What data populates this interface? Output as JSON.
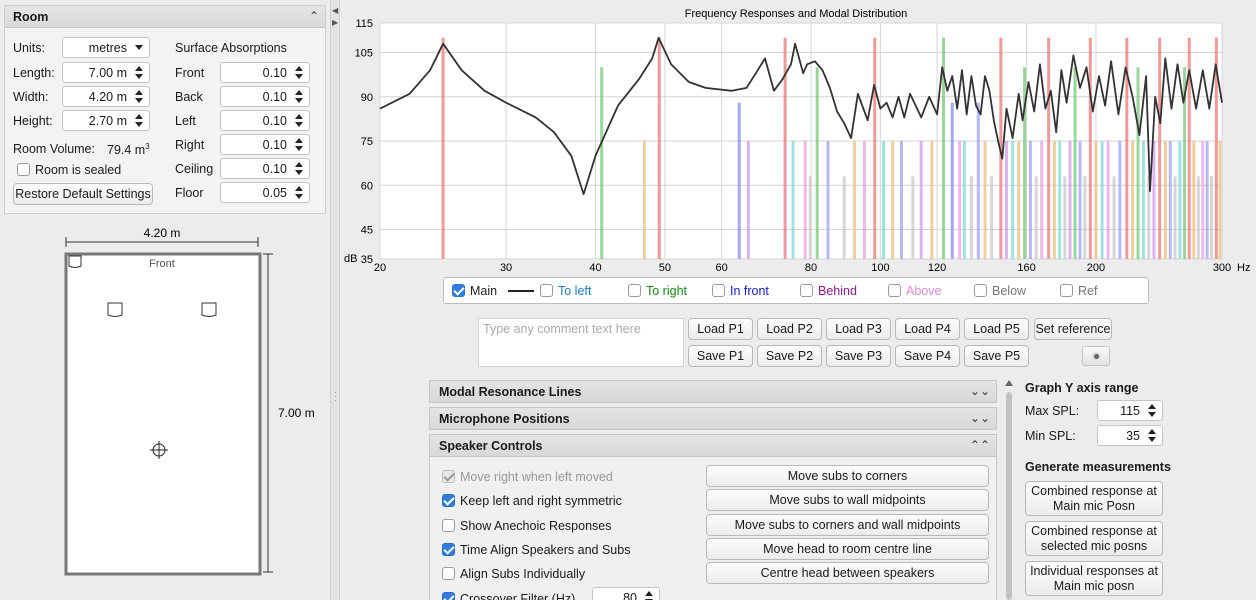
{
  "room": {
    "title": "Room",
    "units_label": "Units:",
    "units_value": "metres",
    "length_label": "Length:",
    "length_value": "7.00 m",
    "width_label": "Width:",
    "width_value": "4.20 m",
    "height_label": "Height:",
    "height_value": "2.70 m",
    "volume_label": "Room Volume:",
    "volume_value": "79.4 m",
    "volume_sup": "3",
    "sealed_label": "Room is sealed",
    "sealed_checked": false,
    "restore_label": "Restore Default Settings",
    "surface_title": "Surface Absorptions",
    "surfaces": [
      {
        "name": "Front",
        "value": "0.10"
      },
      {
        "name": "Back",
        "value": "0.10"
      },
      {
        "name": "Left",
        "value": "0.10"
      },
      {
        "name": "Right",
        "value": "0.10"
      },
      {
        "name": "Ceiling",
        "value": "0.10"
      },
      {
        "name": "Floor",
        "value": "0.05"
      }
    ]
  },
  "diagram": {
    "width_label": "4.20 m",
    "length_label": "7.00 m",
    "front_label": "Front"
  },
  "chart_data": {
    "type": "line",
    "title": "Frequency Responses and Modal Distribution",
    "xlabel": "Hz",
    "ylabel": "dB",
    "x_scale": "log",
    "xlim": [
      20,
      300
    ],
    "ylim": [
      35,
      115
    ],
    "x_ticks": [
      20,
      30,
      40,
      50,
      60,
      80,
      100,
      120,
      160,
      200,
      300
    ],
    "y_ticks": [
      35,
      45,
      60,
      75,
      90,
      105,
      115
    ],
    "grid": true,
    "series": [
      {
        "name": "Main",
        "color": "#333333",
        "points": [
          [
            20,
            86
          ],
          [
            22,
            91
          ],
          [
            23.5,
            99
          ],
          [
            24.5,
            108
          ],
          [
            26,
            99
          ],
          [
            28,
            92
          ],
          [
            30,
            88
          ],
          [
            33,
            83
          ],
          [
            35,
            78
          ],
          [
            37,
            70
          ],
          [
            38.5,
            57
          ],
          [
            40,
            70
          ],
          [
            43,
            87
          ],
          [
            46,
            96
          ],
          [
            48,
            103
          ],
          [
            49,
            110
          ],
          [
            51,
            101
          ],
          [
            54,
            95
          ],
          [
            57,
            93
          ],
          [
            62,
            92
          ],
          [
            65,
            93
          ],
          [
            67,
            98
          ],
          [
            69,
            103
          ],
          [
            71,
            92
          ],
          [
            73,
            96
          ],
          [
            75,
            101
          ],
          [
            76,
            108
          ],
          [
            78,
            98
          ],
          [
            79,
            101
          ],
          [
            81,
            102
          ],
          [
            83,
            99
          ],
          [
            85,
            93
          ],
          [
            87,
            85
          ],
          [
            89,
            81
          ],
          [
            91,
            76
          ],
          [
            93,
            91
          ],
          [
            96,
            82
          ],
          [
            98,
            94
          ],
          [
            100,
            86
          ],
          [
            102,
            88
          ],
          [
            104,
            83
          ],
          [
            106,
            90
          ],
          [
            108,
            83
          ],
          [
            110,
            91
          ],
          [
            112,
            87
          ],
          [
            114,
            83
          ],
          [
            117,
            90
          ],
          [
            120,
            84
          ],
          [
            122,
            100
          ],
          [
            124,
            92
          ],
          [
            126,
            97
          ],
          [
            128,
            86
          ],
          [
            130,
            99
          ],
          [
            132,
            84
          ],
          [
            134,
            97
          ],
          [
            136,
            87
          ],
          [
            138,
            84
          ],
          [
            140,
            97
          ],
          [
            142,
            92
          ],
          [
            144,
            82
          ],
          [
            146,
            75
          ],
          [
            148,
            69
          ],
          [
            150,
            86
          ],
          [
            153,
            76
          ],
          [
            156,
            91
          ],
          [
            158,
            82
          ],
          [
            161,
            95
          ],
          [
            164,
            85
          ],
          [
            167,
            101
          ],
          [
            170,
            86
          ],
          [
            173,
            92
          ],
          [
            176,
            78
          ],
          [
            179,
            99
          ],
          [
            182,
            88
          ],
          [
            186,
            104
          ],
          [
            190,
            93
          ],
          [
            194,
            100
          ],
          [
            198,
            85
          ],
          [
            202,
            97
          ],
          [
            206,
            87
          ],
          [
            210,
            102
          ],
          [
            215,
            84
          ],
          [
            220,
            100
          ],
          [
            225,
            90
          ],
          [
            230,
            77
          ],
          [
            235,
            97
          ],
          [
            238,
            58
          ],
          [
            242,
            90
          ],
          [
            246,
            81
          ],
          [
            250,
            103
          ],
          [
            255,
            86
          ],
          [
            260,
            101
          ],
          [
            265,
            88
          ],
          [
            270,
            99
          ],
          [
            276,
            86
          ],
          [
            282,
            99
          ],
          [
            288,
            86
          ],
          [
            294,
            101
          ],
          [
            300,
            88
          ]
        ]
      }
    ],
    "modes": [
      {
        "f": 24.5,
        "db": 110,
        "color": "#e87878"
      },
      {
        "f": 40.8,
        "db": 100,
        "color": "#78c878"
      },
      {
        "f": 46.8,
        "db": 75,
        "color": "#e8c080"
      },
      {
        "f": 49.1,
        "db": 110,
        "color": "#e87878"
      },
      {
        "f": 63.5,
        "db": 88,
        "color": "#8a8af0"
      },
      {
        "f": 65.4,
        "db": 75,
        "color": "#d09ae8"
      },
      {
        "f": 73.6,
        "db": 110,
        "color": "#e87878"
      },
      {
        "f": 75.5,
        "db": 75,
        "color": "#80d8d8"
      },
      {
        "f": 78.5,
        "db": 75,
        "color": "#e8a0e0"
      },
      {
        "f": 79.8,
        "db": 63,
        "color": "#c8c8c8"
      },
      {
        "f": 81.6,
        "db": 100,
        "color": "#78c878"
      },
      {
        "f": 84.5,
        "db": 75,
        "color": "#a0a0f0"
      },
      {
        "f": 89,
        "db": 63,
        "color": "#c8c8c8"
      },
      {
        "f": 92,
        "db": 75,
        "color": "#e8c080"
      },
      {
        "f": 95,
        "db": 75,
        "color": "#e8a0e0"
      },
      {
        "f": 98.2,
        "db": 110,
        "color": "#e87878"
      },
      {
        "f": 101,
        "db": 75,
        "color": "#80d8d8"
      },
      {
        "f": 104,
        "db": 75,
        "color": "#e8c080"
      },
      {
        "f": 107,
        "db": 75,
        "color": "#a0a0f0"
      },
      {
        "f": 111,
        "db": 63,
        "color": "#c8c8c8"
      },
      {
        "f": 114,
        "db": 75,
        "color": "#d09ae8"
      },
      {
        "f": 118,
        "db": 75,
        "color": "#e8c080"
      },
      {
        "f": 122.5,
        "db": 110,
        "color": "#78c878"
      },
      {
        "f": 126,
        "db": 88,
        "color": "#8a8af0"
      },
      {
        "f": 129,
        "db": 75,
        "color": "#e8a0e0"
      },
      {
        "f": 131,
        "db": 75,
        "color": "#80d8d8"
      },
      {
        "f": 134,
        "db": 63,
        "color": "#c8c8c8"
      },
      {
        "f": 137,
        "db": 88,
        "color": "#a0a0f0"
      },
      {
        "f": 140,
        "db": 75,
        "color": "#e8c080"
      },
      {
        "f": 143,
        "db": 63,
        "color": "#c8c8c8"
      },
      {
        "f": 147.3,
        "db": 110,
        "color": "#e87878"
      },
      {
        "f": 150,
        "db": 75,
        "color": "#d09ae8"
      },
      {
        "f": 153,
        "db": 75,
        "color": "#80d8d8"
      },
      {
        "f": 156,
        "db": 75,
        "color": "#e8c080"
      },
      {
        "f": 159,
        "db": 100,
        "color": "#78c878"
      },
      {
        "f": 162,
        "db": 75,
        "color": "#a0a0f0"
      },
      {
        "f": 165,
        "db": 63,
        "color": "#c8c8c8"
      },
      {
        "f": 168,
        "db": 75,
        "color": "#e8a0e0"
      },
      {
        "f": 171.8,
        "db": 110,
        "color": "#e87878"
      },
      {
        "f": 175,
        "db": 75,
        "color": "#e8c080"
      },
      {
        "f": 178,
        "db": 75,
        "color": "#80d8d8"
      },
      {
        "f": 181,
        "db": 63,
        "color": "#c8c8c8"
      },
      {
        "f": 184,
        "db": 75,
        "color": "#d09ae8"
      },
      {
        "f": 187,
        "db": 100,
        "color": "#78c878"
      },
      {
        "f": 190,
        "db": 75,
        "color": "#a0a0f0"
      },
      {
        "f": 193,
        "db": 63,
        "color": "#c8c8c8"
      },
      {
        "f": 196.4,
        "db": 110,
        "color": "#e87878"
      },
      {
        "f": 200,
        "db": 75,
        "color": "#e8c080"
      },
      {
        "f": 204,
        "db": 75,
        "color": "#80d8d8"
      },
      {
        "f": 208,
        "db": 75,
        "color": "#e8a0e0"
      },
      {
        "f": 212,
        "db": 63,
        "color": "#c8c8c8"
      },
      {
        "f": 216,
        "db": 75,
        "color": "#a0a0f0"
      },
      {
        "f": 220.9,
        "db": 110,
        "color": "#e87878"
      },
      {
        "f": 225,
        "db": 75,
        "color": "#e8c080"
      },
      {
        "f": 229,
        "db": 100,
        "color": "#78c878"
      },
      {
        "f": 233,
        "db": 75,
        "color": "#80d8d8"
      },
      {
        "f": 237,
        "db": 63,
        "color": "#c8c8c8"
      },
      {
        "f": 241,
        "db": 75,
        "color": "#d09ae8"
      },
      {
        "f": 245.5,
        "db": 110,
        "color": "#e87878"
      },
      {
        "f": 250,
        "db": 75,
        "color": "#e8c080"
      },
      {
        "f": 254,
        "db": 75,
        "color": "#a0a0f0"
      },
      {
        "f": 258,
        "db": 63,
        "color": "#c8c8c8"
      },
      {
        "f": 262,
        "db": 75,
        "color": "#80d8d8"
      },
      {
        "f": 266,
        "db": 100,
        "color": "#78c878"
      },
      {
        "f": 270,
        "db": 110,
        "color": "#e87878"
      },
      {
        "f": 274,
        "db": 75,
        "color": "#e8c080"
      },
      {
        "f": 278,
        "db": 63,
        "color": "#c8c8c8"
      },
      {
        "f": 282,
        "db": 75,
        "color": "#e8a0e0"
      },
      {
        "f": 286,
        "db": 75,
        "color": "#a0a0f0"
      },
      {
        "f": 290,
        "db": 63,
        "color": "#c8c8c8"
      },
      {
        "f": 294.6,
        "db": 110,
        "color": "#e87878"
      },
      {
        "f": 298,
        "db": 75,
        "color": "#e8c080"
      }
    ]
  },
  "legend": {
    "items": [
      {
        "label": "Main",
        "checked": true,
        "color": "#222222"
      },
      {
        "label": "To left",
        "checked": false,
        "color": "#1a7fc1"
      },
      {
        "label": "To right",
        "checked": false,
        "color": "#1a8a1a"
      },
      {
        "label": "In front",
        "checked": false,
        "color": "#1a1acc"
      },
      {
        "label": "Behind",
        "checked": false,
        "color": "#8a1a8a"
      },
      {
        "label": "Above",
        "checked": false,
        "color": "#d88ad8"
      },
      {
        "label": "Below",
        "checked": false,
        "color": "#777777"
      },
      {
        "label": "Ref",
        "checked": false,
        "color": "#777777"
      }
    ]
  },
  "comment_placeholder": "Type any comment text here",
  "load_buttons": [
    "Load P1",
    "Load P2",
    "Load P3",
    "Load P4",
    "Load P5"
  ],
  "save_buttons": [
    "Save P1",
    "Save P2",
    "Save P3",
    "Save P4",
    "Save P5"
  ],
  "set_reference_label": "Set reference",
  "sections": {
    "modal": "Modal Resonance Lines",
    "mic": "Microphone Positions",
    "speaker": "Speaker Controls"
  },
  "speaker_controls": {
    "checks": [
      {
        "label": "Move right when left moved",
        "checked": true,
        "disabled": true
      },
      {
        "label": "Keep left and right symmetric",
        "checked": true,
        "disabled": false
      },
      {
        "label": "Show Anechoic Responses",
        "checked": false,
        "disabled": false
      },
      {
        "label": "Time Align Speakers and Subs",
        "checked": true,
        "disabled": false
      },
      {
        "label": "Align Subs Individually",
        "checked": false,
        "disabled": false
      },
      {
        "label": "Crossover Filter (Hz)",
        "checked": true,
        "disabled": false
      }
    ],
    "crossover_value": "80",
    "buttons": [
      "Move subs to corners",
      "Move subs to wall midpoints",
      "Move subs to corners and wall midpoints",
      "Move head to room centre line",
      "Centre head between speakers"
    ]
  },
  "graph_range": {
    "title": "Graph Y axis range",
    "max_label": "Max SPL:",
    "max_value": "115",
    "min_label": "Min SPL:",
    "min_value": "35"
  },
  "generate": {
    "title": "Generate measurements",
    "buttons": [
      {
        "line1": "Combined response at",
        "line2": "Main mic Posn"
      },
      {
        "line1": "Combined response at",
        "line2": "selected mic posns"
      },
      {
        "line1": "Individual responses at",
        "line2": "Main mic posn"
      }
    ]
  }
}
